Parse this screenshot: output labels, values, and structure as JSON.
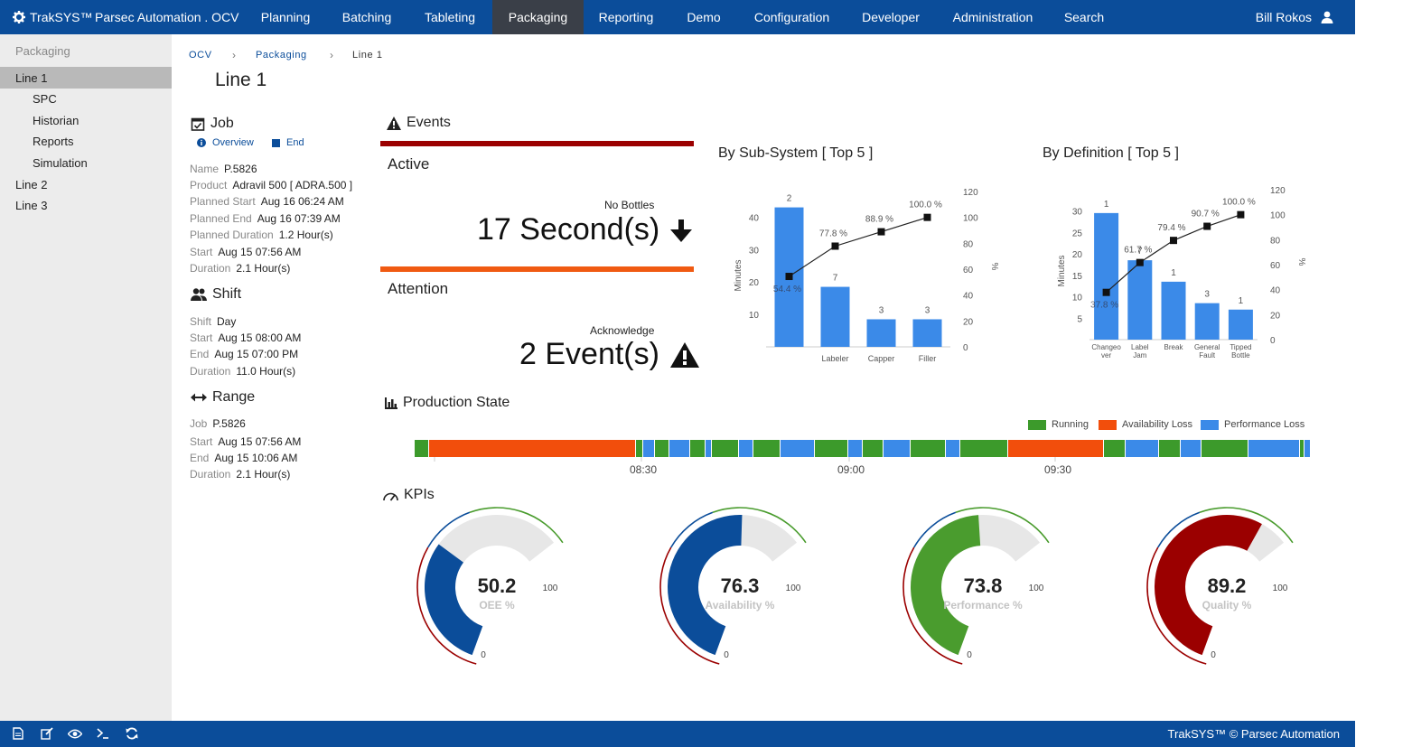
{
  "app": {
    "brand": "TrakSYS™",
    "site": "Parsec Automation . OCV",
    "user": "Bill Rokos"
  },
  "nav": {
    "items": [
      {
        "label": "Planning"
      },
      {
        "label": "Batching"
      },
      {
        "label": "Tableting"
      },
      {
        "label": "Packaging",
        "active": true
      },
      {
        "label": "Reporting"
      },
      {
        "label": "Demo"
      },
      {
        "label": "Configuration"
      },
      {
        "label": "Developer"
      },
      {
        "label": "Administration"
      },
      {
        "label": "Search"
      }
    ]
  },
  "sidebar": {
    "header": "Packaging",
    "items": [
      {
        "label": "Line 1",
        "active": true
      },
      {
        "label": "SPC"
      },
      {
        "label": "Historian"
      },
      {
        "label": "Reports"
      },
      {
        "label": "Simulation"
      },
      {
        "label": "Line 2"
      },
      {
        "label": "Line 3"
      }
    ]
  },
  "breadcrumb": {
    "items": [
      "OCV",
      "Packaging",
      "Line 1"
    ]
  },
  "page": {
    "title": "Line 1"
  },
  "job": {
    "title": "Job",
    "links": {
      "overview": "Overview",
      "end": "End"
    },
    "fields": [
      {
        "k": "Name",
        "v": "P.5826"
      },
      {
        "k": "Product",
        "v": "Adravil 500 [ ADRA.500 ]"
      },
      {
        "k": "Planned Start",
        "v": "Aug 16 06:24 AM"
      },
      {
        "k": "Planned End",
        "v": "Aug 16 07:39 AM"
      },
      {
        "k": "Planned Duration",
        "v": "1.2 Hour(s)"
      },
      {
        "k": "Start",
        "v": "Aug 15 07:56 AM"
      },
      {
        "k": "Duration",
        "v": "2.1 Hour(s)"
      }
    ]
  },
  "shift": {
    "title": "Shift",
    "fields": [
      {
        "k": "Shift",
        "v": "Day"
      },
      {
        "k": "Start",
        "v": "Aug 15 08:00 AM"
      },
      {
        "k": "End",
        "v": "Aug 15 07:00 PM"
      },
      {
        "k": "Duration",
        "v": "11.0 Hour(s)"
      }
    ]
  },
  "range": {
    "title": "Range",
    "fields": [
      {
        "k": "Job",
        "v": "P.5826"
      },
      {
        "k": "Start",
        "v": "Aug 15 07:56 AM"
      },
      {
        "k": "End",
        "v": "Aug 15 10:06 AM"
      },
      {
        "k": "Duration",
        "v": "2.1 Hour(s)"
      }
    ]
  },
  "events": {
    "title": "Events",
    "active": {
      "label": "Active",
      "small": "No Bottles",
      "big": "17 Second(s)",
      "color": "#9b0000"
    },
    "attention": {
      "label": "Attention",
      "small": "Acknowledge",
      "big": "2 Event(s)",
      "color": "#f05a12"
    }
  },
  "production": {
    "title": "Production State",
    "legend": [
      {
        "label": "Running",
        "color": "#3c9a2b"
      },
      {
        "label": "Availability Loss",
        "color": "#f24e0c"
      },
      {
        "label": "Performance Loss",
        "color": "#3b8ae8"
      }
    ],
    "ticks": [
      "08:30",
      "09:00",
      "09:30"
    ]
  },
  "kpis": {
    "title": "KPIs",
    "items": [
      {
        "value": "50.2",
        "label": "OEE %",
        "pct": 50.2,
        "color": "#0b4d9a"
      },
      {
        "value": "76.3",
        "label": "Availability %",
        "pct": 76.3,
        "color": "#0b4d9a"
      },
      {
        "value": "73.8",
        "label": "Performance %",
        "pct": 73.8,
        "color": "#4a9c2e"
      },
      {
        "value": "89.2",
        "label": "Quality %",
        "pct": 89.2,
        "color": "#9b0000"
      }
    ],
    "min": "0",
    "max": "100"
  },
  "footer": {
    "copyright": "TrakSYS™ © Parsec Automation"
  },
  "colors": {
    "brand": "#0b4d9a",
    "bar": "#3b8ae8"
  },
  "chart_data": [
    {
      "type": "bar",
      "title": "By Sub-System [ Top 5 ]",
      "categories": [
        "",
        "Labeler",
        "Capper",
        "Filler"
      ],
      "values": [
        43,
        18.5,
        8.5,
        8.5
      ],
      "data_labels": [
        "2",
        "7",
        "3",
        "3"
      ],
      "ylabel": "Minutes",
      "ylim": [
        0,
        44
      ],
      "yticks": [
        "10",
        "20",
        "30",
        "40"
      ],
      "y2label": "%",
      "y2ticks": [
        "0",
        "20",
        "40",
        "60",
        "80",
        "100",
        "120"
      ],
      "cumulative_pct": [
        54.4,
        77.8,
        88.9,
        100.0
      ],
      "cumulative_labels": [
        "54.4 %",
        "77.8 %",
        "88.9 %",
        "100.0 %"
      ]
    },
    {
      "type": "bar",
      "title": "By Definition [ Top 5 ]",
      "categories": [
        "Changeover",
        "Label Jam",
        "Break",
        "General Fault",
        "Tipped Bottle"
      ],
      "values": [
        29.5,
        18.5,
        13.5,
        8.5,
        7
      ],
      "data_labels": [
        "1",
        "7",
        "1",
        "3",
        "1"
      ],
      "ylabel": "Minutes",
      "ylim": [
        0,
        32
      ],
      "yticks": [
        "5",
        "10",
        "15",
        "20",
        "25",
        "30"
      ],
      "y2label": "%",
      "y2ticks": [
        "0",
        "20",
        "40",
        "60",
        "80",
        "100",
        "120"
      ],
      "cumulative_pct": [
        37.8,
        61.7,
        79.4,
        90.7,
        100.0
      ],
      "cumulative_labels": [
        "37.8 %",
        "61.7 %",
        "79.4 %",
        "90.7 %",
        "100.0 %"
      ]
    }
  ]
}
